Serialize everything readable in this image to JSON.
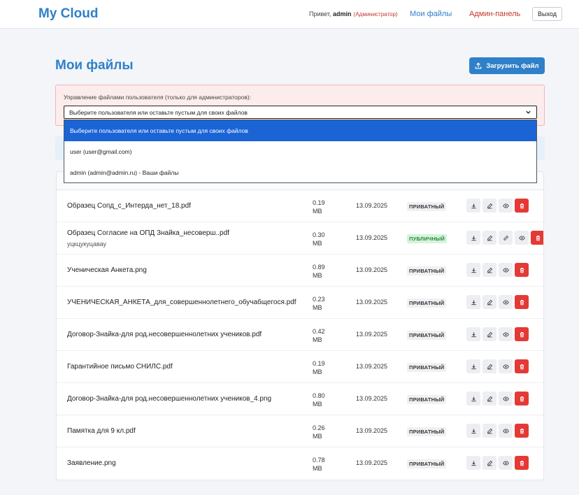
{
  "header": {
    "logo": "My Cloud",
    "greeting_prefix": "Привет, ",
    "username": "admin",
    "role": "(Администратор)",
    "nav_files": "Мои файлы",
    "nav_admin": "Админ-панель",
    "logout": "Выход"
  },
  "main": {
    "title": "Мои файлы",
    "upload_label": "Загрузить файл"
  },
  "admin_panel": {
    "label": "Управление файлами пользователя (только для администраторов):",
    "selected_value": "Выберите пользователя или оставьте пустым для своих файлов",
    "options": [
      "Выберите пользователя или оставьте пустым для своих файлов",
      "user (user@gmail.com)",
      "admin (admin@admin.ru) - Ваши файлы"
    ]
  },
  "files": [
    {
      "name": "Образец Сопд_с_Интерда_нет_18.pdf",
      "description": "",
      "size": "0.19 MB",
      "date": "13.09.2025",
      "status": "ПРИВАТНЫЙ",
      "public": false
    },
    {
      "name": "Образец Согласие на ОПД Знайка_несоверш..pdf",
      "description": "уцкцукуцавау",
      "size": "0.30 MB",
      "date": "13.09.2025",
      "status": "ПУБЛИЧНЫЙ",
      "public": true
    },
    {
      "name": "Ученическая Анкета.png",
      "description": "",
      "size": "0.89 MB",
      "date": "13.09.2025",
      "status": "ПРИВАТНЫЙ",
      "public": false
    },
    {
      "name": "УЧЕНИЧЕСКАЯ_АНКЕТА_для_совершеннолетнего_обучабщегося.pdf",
      "description": "",
      "size": "0.23 MB",
      "date": "13.09.2025",
      "status": "ПРИВАТНЫЙ",
      "public": false
    },
    {
      "name": "Договор-Знайка-для род.несовершеннолетних учеников.pdf",
      "description": "",
      "size": "0.42 MB",
      "date": "13.09.2025",
      "status": "ПРИВАТНЫЙ",
      "public": false
    },
    {
      "name": "Гарантийное письмо СНИЛС.pdf",
      "description": "",
      "size": "0.19 MB",
      "date": "13.09.2025",
      "status": "ПРИВАТНЫЙ",
      "public": false
    },
    {
      "name": "Договор-Знайка-для род.несовершеннолетних учеников_4.png",
      "description": "",
      "size": "0.80 MB",
      "date": "13.09.2025",
      "status": "ПРИВАТНЫЙ",
      "public": false
    },
    {
      "name": "Памятка для 9 кл.pdf",
      "description": "",
      "size": "0.26 MB",
      "date": "13.09.2025",
      "status": "ПРИВАТНЫЙ",
      "public": false
    },
    {
      "name": "Заявление.png",
      "description": "",
      "size": "0.78 MB",
      "date": "13.09.2025",
      "status": "ПРИВАТНЫЙ",
      "public": false
    }
  ],
  "icons": {
    "download": "download-icon",
    "edit": "edit-icon",
    "link": "link-icon",
    "view": "eye-icon",
    "delete": "trash-icon",
    "upload": "upload-icon"
  },
  "colors": {
    "accent": "#2f80c9",
    "danger": "#e53935",
    "admin_link": "#c0392b",
    "public_badge": "#d6f3dc",
    "dropdown_highlight": "#1a64d6"
  }
}
